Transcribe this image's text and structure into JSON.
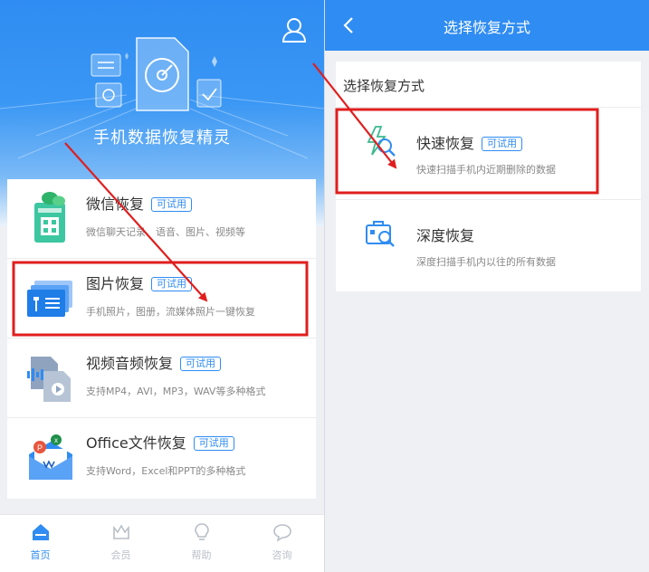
{
  "left": {
    "hero_title": "手机数据恢复精灵",
    "cards": [
      {
        "title": "微信恢复",
        "badge": "可试用",
        "desc": "微信聊天记录、语音、图片、视频等",
        "icon": "wechat-recovery-icon"
      },
      {
        "title": "图片恢复",
        "badge": "可试用",
        "desc": "手机照片，图册，流媒体照片一键恢复",
        "icon": "photo-recovery-icon"
      },
      {
        "title": "视频音频恢复",
        "badge": "可试用",
        "desc": "支持MP4，AVI，MP3，WAV等多种格式",
        "icon": "video-audio-recovery-icon"
      },
      {
        "title": "Office文件恢复",
        "badge": "可试用",
        "desc": "支持Word，Excel和PPT的多种格式",
        "icon": "office-recovery-icon"
      }
    ],
    "tabs": [
      {
        "label": "首页",
        "icon": "home-icon",
        "active": true
      },
      {
        "label": "会员",
        "icon": "crown-icon",
        "active": false
      },
      {
        "label": "帮助",
        "icon": "lightbulb-icon",
        "active": false
      },
      {
        "label": "咨询",
        "icon": "chat-bubble-icon",
        "active": false
      }
    ]
  },
  "right": {
    "nav_title": "选择恢复方式",
    "panel_heading": "选择恢复方式",
    "options": [
      {
        "title": "快速恢复",
        "badge": "可试用",
        "desc": "快速扫描手机内近期删除的数据",
        "icon": "quick-scan-icon"
      },
      {
        "title": "深度恢复",
        "badge": "",
        "desc": "深度扫描手机内以往的所有数据",
        "icon": "deep-scan-icon"
      }
    ]
  },
  "colors": {
    "brand_blue": "#2f8cf2",
    "highlight_red": "#e01e1e",
    "text_primary": "#333333",
    "text_secondary": "#888888"
  }
}
